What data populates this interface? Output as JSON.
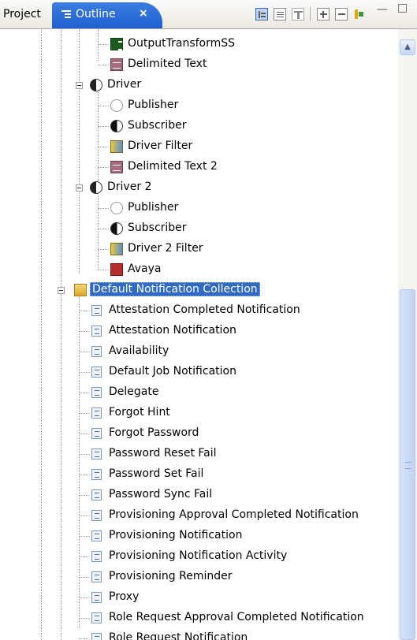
{
  "tabs": {
    "project": "Project",
    "outline": "Outline",
    "close": "×"
  },
  "toolbar_icons": [
    "hierarchy-icon",
    "new-view-icon",
    "filter-icon",
    "expand-all-icon",
    "collapse-all-icon",
    "sync-icon",
    "minimize-icon",
    "maximize-icon"
  ],
  "tree": [
    {
      "label": "OutputTransformSS",
      "icon": "stylesheet-icon"
    },
    {
      "label": "Delimited Text",
      "icon": "delimited-text-icon"
    },
    {
      "label": "Driver",
      "icon": "driver-icon"
    },
    {
      "label": "Publisher",
      "icon": "publisher-icon"
    },
    {
      "label": "Subscriber",
      "icon": "subscriber-icon"
    },
    {
      "label": "Driver Filter",
      "icon": "filter-icon"
    },
    {
      "label": "Delimited Text 2",
      "icon": "delimited-text-icon"
    },
    {
      "label": "Driver 2",
      "icon": "driver-icon"
    },
    {
      "label": "Publisher",
      "icon": "publisher-icon"
    },
    {
      "label": "Subscriber",
      "icon": "subscriber-icon"
    },
    {
      "label": "Driver 2 Filter",
      "icon": "filter-icon"
    },
    {
      "label": "Avaya",
      "icon": "avaya-icon"
    },
    {
      "label": "Default Notification Collection",
      "icon": "notification-collection-icon"
    },
    {
      "label": "Attestation Completed Notification",
      "icon": "notification-template-icon"
    },
    {
      "label": "Attestation Notification",
      "icon": "notification-template-icon"
    },
    {
      "label": "Availability",
      "icon": "notification-template-icon"
    },
    {
      "label": "Default Job Notification",
      "icon": "notification-template-icon"
    },
    {
      "label": "Delegate",
      "icon": "notification-template-icon"
    },
    {
      "label": "Forgot Hint",
      "icon": "notification-template-icon"
    },
    {
      "label": "Forgot Password",
      "icon": "notification-template-icon"
    },
    {
      "label": "Password Reset Fail",
      "icon": "notification-template-icon"
    },
    {
      "label": "Password Set Fail",
      "icon": "notification-template-icon"
    },
    {
      "label": "Password Sync Fail",
      "icon": "notification-template-icon"
    },
    {
      "label": "Provisioning Approval Completed Notification",
      "icon": "notification-template-icon"
    },
    {
      "label": "Provisioning Notification",
      "icon": "notification-template-icon"
    },
    {
      "label": "Provisioning Notification Activity",
      "icon": "notification-template-icon"
    },
    {
      "label": "Provisioning Reminder",
      "icon": "notification-template-icon"
    },
    {
      "label": "Proxy",
      "icon": "notification-template-icon"
    },
    {
      "label": "Role Request Approval Completed Notification",
      "icon": "notification-template-icon"
    },
    {
      "label": "Role Request Notification",
      "icon": "notification-template-icon"
    }
  ],
  "colors": {
    "tab_active": "#1f5fd1",
    "selection": "#316ac5",
    "scroll_thumb": "#c2d3f6"
  }
}
